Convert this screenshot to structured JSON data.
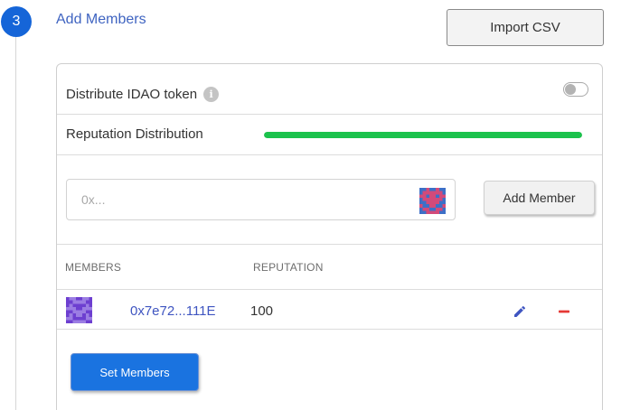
{
  "step": {
    "number": "3",
    "title": "Add Members"
  },
  "import_csv_label": "Import CSV",
  "distribute": {
    "label": "Distribute IDAO token",
    "info_icon": "info-icon",
    "toggle_on": false
  },
  "reputation": {
    "label": "Reputation Distribution",
    "progress_fraction": 1.0,
    "bar_color": "#1bc24c"
  },
  "address_input": {
    "placeholder": "0x...",
    "value": ""
  },
  "add_member_label": "Add Member",
  "table": {
    "headers": {
      "members": "MEMBERS",
      "reputation": "REPUTATION"
    },
    "rows": [
      {
        "address": "0x7e72...111E",
        "reputation": "100",
        "edit_icon": "pencil-icon",
        "remove_icon": "minus-icon"
      }
    ]
  },
  "set_members_label": "Set Members",
  "colors": {
    "accent": "#1565d8",
    "link": "#3f55c1",
    "danger": "#e53935"
  }
}
